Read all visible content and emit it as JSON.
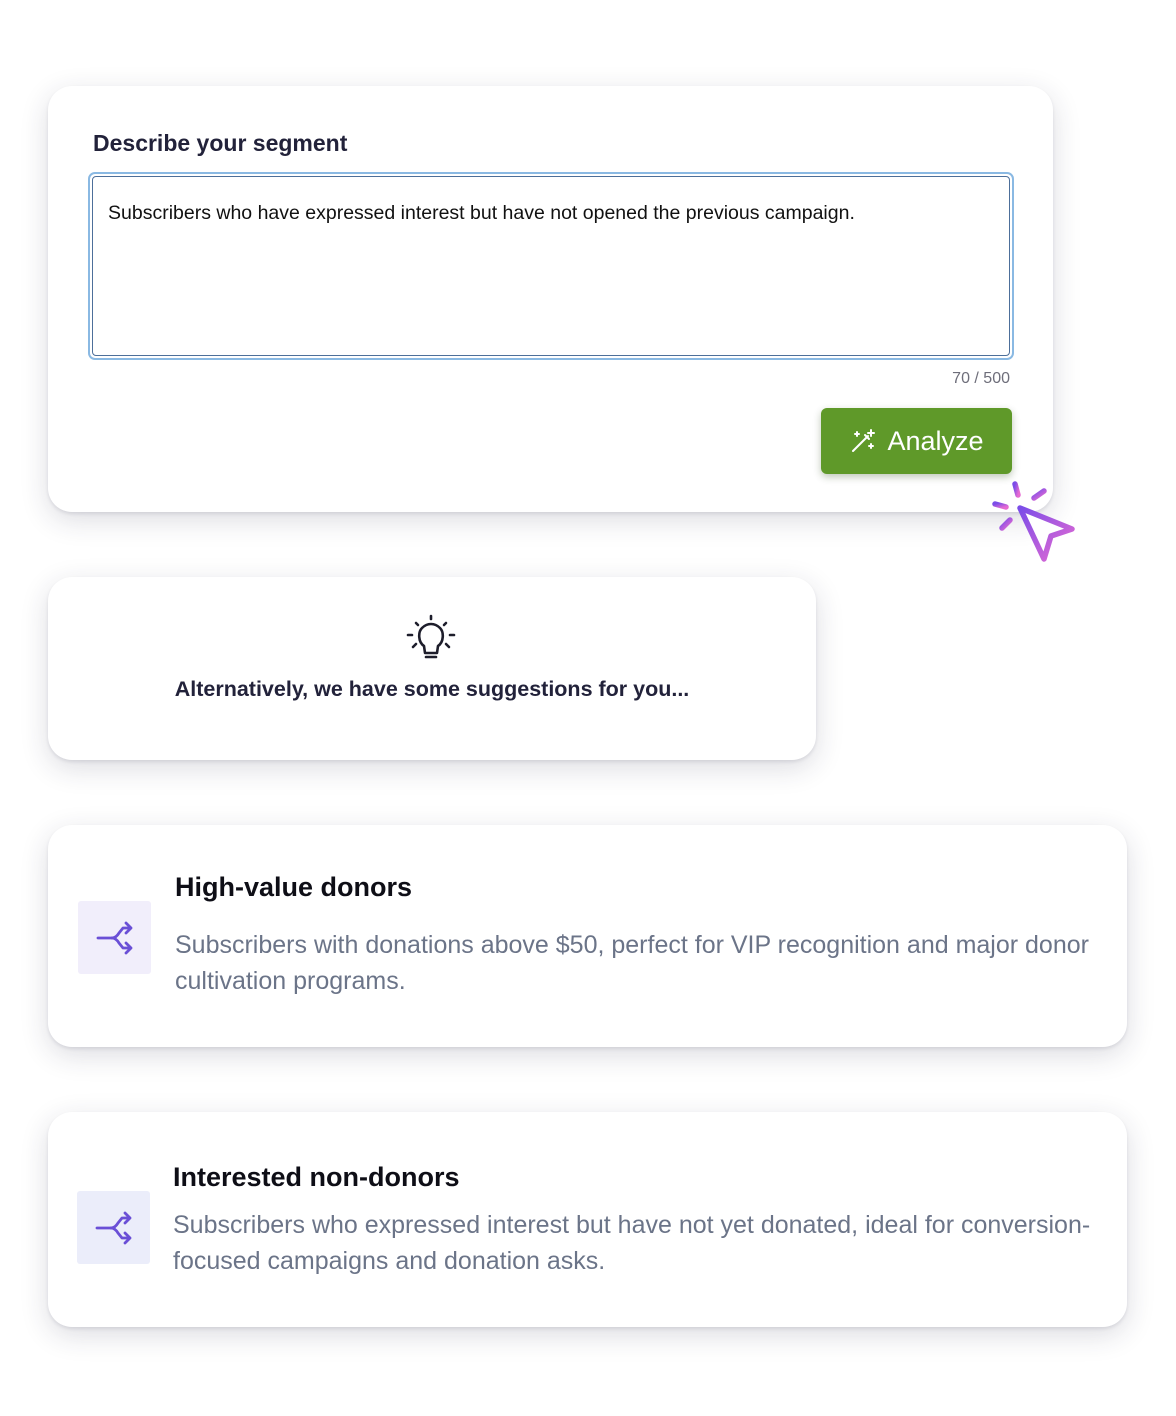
{
  "segment_form": {
    "title": "Describe your segment",
    "description_value": "Subscribers who have expressed interest but have not opened the previous campaign.",
    "char_count": "70 / 500",
    "analyze_label": "Analyze",
    "analyze_icon": "magic-wand-icon"
  },
  "suggestions": {
    "icon": "lightbulb-icon",
    "heading": "Alternatively, we have some suggestions for you..."
  },
  "segments": [
    {
      "icon": "split-arrows-icon",
      "title": "High-value donors",
      "description": "Subscribers with donations above $50, perfect for VIP recognition and major donor cultivation programs."
    },
    {
      "icon": "split-arrows-icon",
      "title": "Interested non-donors",
      "description": "Subscribers who expressed interest but have not yet donated, ideal for conversion-focused campaigns and donation asks."
    }
  ],
  "colors": {
    "primary_button": "#5f9929",
    "focus_border": "#8ab9e3",
    "segment_icon": "#6a4fd6",
    "cursor_gradient_start": "#7b4de8",
    "cursor_gradient_end": "#e66bd2"
  }
}
